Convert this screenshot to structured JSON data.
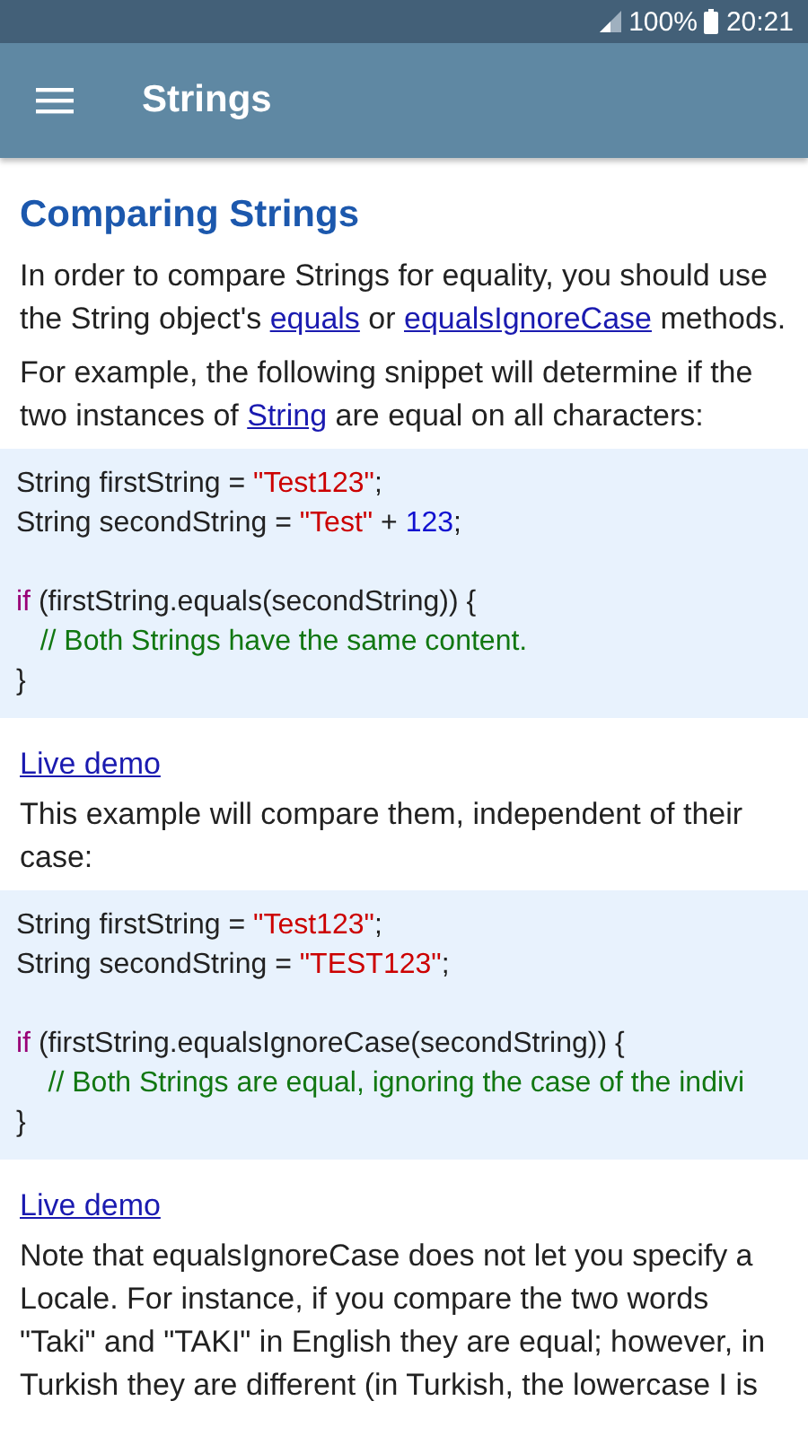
{
  "status_bar": {
    "battery": "100%",
    "time": "20:21"
  },
  "app_bar": {
    "title": "Strings"
  },
  "content": [
    {
      "kind": "heading",
      "text": "Comparing Strings"
    },
    {
      "kind": "paragraph",
      "parts": [
        {
          "text": "In order to compare Strings for equality, you should use the String object's "
        },
        {
          "link": "equals"
        },
        {
          "text": " or "
        },
        {
          "link": "equalsIgnoreCase"
        },
        {
          "text": " methods."
        }
      ]
    },
    {
      "kind": "paragraph",
      "parts": [
        {
          "text": "For example, the following snippet will determine if the two instances of "
        },
        {
          "link": "String"
        },
        {
          "text": " are equal on all characters:"
        }
      ]
    },
    {
      "kind": "code",
      "groups": [
        [
          [
            {
              "kind": "plain",
              "text": "String firstString = "
            },
            {
              "kind": "string",
              "text": "\"Test123\""
            },
            {
              "kind": "plain",
              "text": ";"
            }
          ],
          [
            {
              "kind": "plain",
              "text": "String secondString = "
            },
            {
              "kind": "string",
              "text": "\"Test\""
            },
            {
              "kind": "plain",
              "text": " + "
            },
            {
              "kind": "number",
              "text": "123"
            },
            {
              "kind": "plain",
              "text": ";"
            }
          ]
        ],
        [
          [
            {
              "kind": "keyword",
              "text": "if"
            },
            {
              "kind": "plain",
              "text": " (firstString.equals(secondString)) {"
            }
          ],
          [
            {
              "kind": "comment",
              "text": "   // Both Strings have the same content."
            }
          ],
          [
            {
              "kind": "plain",
              "text": "}"
            }
          ]
        ]
      ]
    },
    {
      "kind": "link",
      "text": "Live demo"
    },
    {
      "kind": "paragraph",
      "parts": [
        {
          "text": "This example will compare them, independent of their case:"
        }
      ]
    },
    {
      "kind": "code",
      "groups": [
        [
          [
            {
              "kind": "plain",
              "text": "String firstString = "
            },
            {
              "kind": "string",
              "text": "\"Test123\""
            },
            {
              "kind": "plain",
              "text": ";"
            }
          ],
          [
            {
              "kind": "plain",
              "text": "String secondString = "
            },
            {
              "kind": "string",
              "text": "\"TEST123\""
            },
            {
              "kind": "plain",
              "text": ";"
            }
          ]
        ],
        [
          [
            {
              "kind": "keyword",
              "text": "if"
            },
            {
              "kind": "plain",
              "text": " (firstString.equalsIgnoreCase(secondString)) {"
            }
          ],
          [
            {
              "kind": "comment",
              "text": "    // Both Strings are equal, ignoring the case of the indivi"
            }
          ],
          [
            {
              "kind": "plain",
              "text": "}"
            }
          ]
        ]
      ]
    },
    {
      "kind": "link",
      "text": "Live demo"
    },
    {
      "kind": "paragraph",
      "parts": [
        {
          "text": "Note that equalsIgnoreCase does not let you specify a Locale. For instance, if you compare the two words \"Taki\" and \"TAKI\" in English they are equal; however, in Turkish they are different (in Turkish, the lowercase I is"
        }
      ]
    }
  ]
}
